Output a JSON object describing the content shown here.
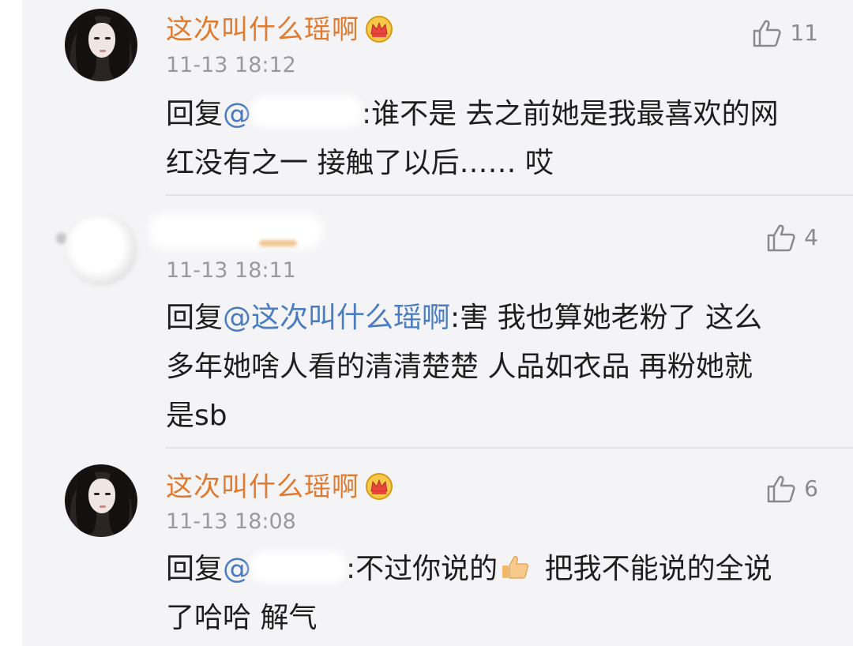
{
  "comments": [
    {
      "username": "这次叫什么瑶啊",
      "badge_icon": "crown-icon",
      "time": "11-13 18:12",
      "likes": "11",
      "reply_prefix": "回复",
      "mention": "@",
      "mention_redacted": true,
      "lines": [
        ":谁不是 去之前她是我最喜欢的网",
        "红没有之一 接触了以后…… 哎"
      ]
    },
    {
      "username_redacted": true,
      "time": "11-13 18:11",
      "likes": "4",
      "reply_prefix": "回复",
      "mention": "@这次叫什么瑶啊",
      "lines": [
        ":害 我也算她老粉了 这么",
        "多年她啥人看的清清楚楚 人品如衣品 再粉她就",
        "是sb"
      ]
    },
    {
      "username": "这次叫什么瑶啊",
      "badge_icon": "crown-icon",
      "time": "11-13 18:08",
      "likes": "6",
      "reply_prefix": "回复",
      "mention": "@",
      "mention_redacted": true,
      "lines": [
        ":不过你说的",
        " 把我不能说的全说",
        "了哈哈 解气"
      ],
      "inline_emoji": "thumbs-up-emoji"
    }
  ],
  "colors": {
    "username": "#e07a2e",
    "mention": "#4a7cc0",
    "time": "#9a9a9a",
    "background": "#f4f4f6"
  }
}
